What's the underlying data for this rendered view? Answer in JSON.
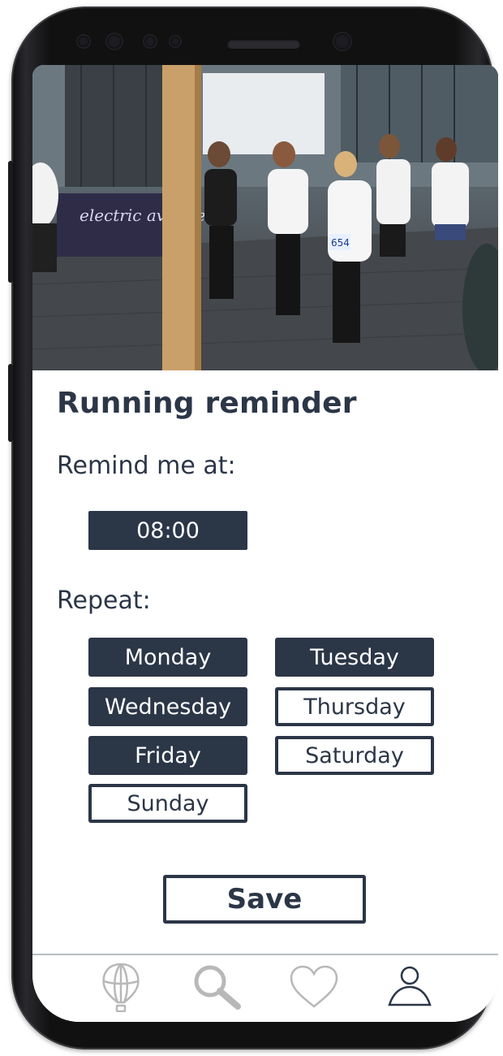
{
  "screen": {
    "title": "Running reminder",
    "remind_label": "Remind me at:",
    "time_value": "08:00",
    "repeat_label": "Repeat:",
    "days": [
      {
        "label": "Monday",
        "selected": true
      },
      {
        "label": "Tuesday",
        "selected": true
      },
      {
        "label": "Wednesday",
        "selected": true
      },
      {
        "label": "Thursday",
        "selected": false
      },
      {
        "label": "Friday",
        "selected": true
      },
      {
        "label": "Saturday",
        "selected": false
      },
      {
        "label": "Sunday",
        "selected": false
      }
    ],
    "save_label": "Save"
  },
  "hero": {
    "banner_text": "electric avenue",
    "bib_number": "654"
  },
  "nav": {
    "items": [
      {
        "icon": "balloon-icon",
        "active": false
      },
      {
        "icon": "search-icon",
        "active": false
      },
      {
        "icon": "heart-icon",
        "active": false
      },
      {
        "icon": "profile-icon",
        "active": true
      }
    ]
  },
  "colors": {
    "primary": "#2b3647",
    "inactive_icon": "#b8b8b8",
    "background": "#ffffff"
  }
}
